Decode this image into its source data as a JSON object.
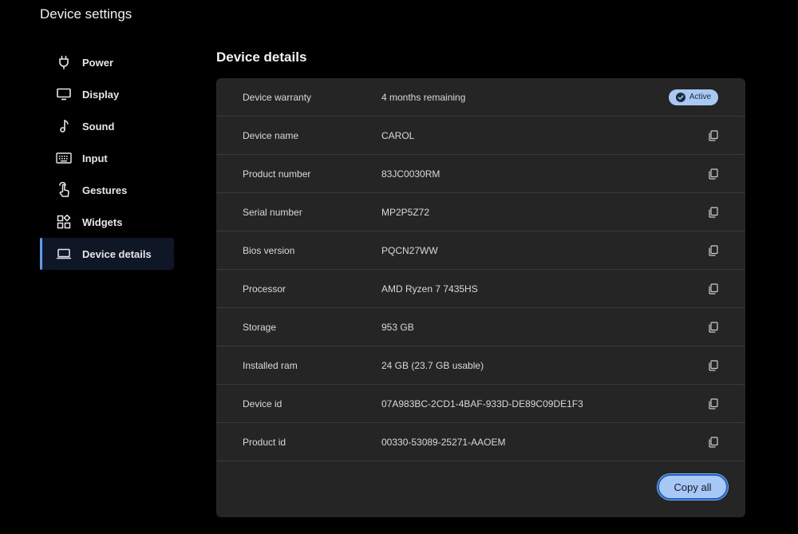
{
  "app": {
    "title": "Device settings"
  },
  "sidebar": {
    "items": [
      {
        "label": "Power",
        "icon": "power-plug-icon",
        "active": false
      },
      {
        "label": "Display",
        "icon": "monitor-icon",
        "active": false
      },
      {
        "label": "Sound",
        "icon": "music-note-icon",
        "active": false
      },
      {
        "label": "Input",
        "icon": "keyboard-icon",
        "active": false
      },
      {
        "label": "Gestures",
        "icon": "touch-hand-icon",
        "active": false
      },
      {
        "label": "Widgets",
        "icon": "widgets-icon",
        "active": false
      },
      {
        "label": "Device details",
        "icon": "laptop-icon",
        "active": true
      }
    ]
  },
  "main": {
    "title": "Device details",
    "rows": [
      {
        "label": "Device warranty",
        "value": "4 months remaining",
        "badge": "Active"
      },
      {
        "label": "Device name",
        "value": "CAROL"
      },
      {
        "label": "Product number",
        "value": "83JC0030RM"
      },
      {
        "label": "Serial number",
        "value": "MP2P5Z72"
      },
      {
        "label": "Bios version",
        "value": "PQCN27WW"
      },
      {
        "label": "Processor",
        "value": "AMD Ryzen 7 7435HS"
      },
      {
        "label": "Storage",
        "value": "953 GB"
      },
      {
        "label": "Installed ram",
        "value": "24 GB (23.7 GB usable)"
      },
      {
        "label": "Device id",
        "value": "07A983BC-2CD1-4BAF-933D-DE89C09DE1F3"
      },
      {
        "label": "Product id",
        "value": "00330-53089-25271-AAOEM"
      }
    ],
    "copy_all_label": "Copy all"
  },
  "colors": {
    "background": "#000000",
    "card": "#252526",
    "accent": "#5b9bf0",
    "badge": "#a9c8f2",
    "button": "#a8c8f5"
  }
}
